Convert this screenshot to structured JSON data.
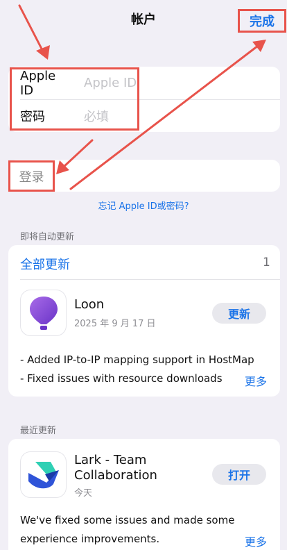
{
  "nav": {
    "title": "帐户",
    "done_label": "完成"
  },
  "login": {
    "apple_id_label": "Apple ID",
    "apple_id_placeholder": "Apple ID",
    "password_label": "密码",
    "password_placeholder": "必填",
    "sign_in_label": "登录",
    "forgot_link": "忘记 Apple ID或密码?"
  },
  "upcoming": {
    "section_title": "即将自动更新",
    "update_all_label": "全部更新",
    "count": "1",
    "app": {
      "name": "Loon",
      "date": "2025 年 9 月 17 日",
      "button_label": "更新",
      "notes": [
        "- Added IP-to-IP mapping support in HostMap",
        "- Fixed issues with resource downloads"
      ],
      "more_label": "更多"
    }
  },
  "recent": {
    "section_title": "最近更新",
    "app": {
      "name_line1": "Lark - Team",
      "name_line2": "Collaboration",
      "date": "今天",
      "button_label": "打开",
      "notes": [
        "We've fixed some issues and made some",
        "experience improvements."
      ],
      "more_label": "更多"
    }
  },
  "colors": {
    "accent": "#1a73e8",
    "annotation": "#e8534b",
    "background": "#f1eff6"
  },
  "icons": {
    "loon": "balloon-icon",
    "lark": "lark-bird-icon"
  }
}
